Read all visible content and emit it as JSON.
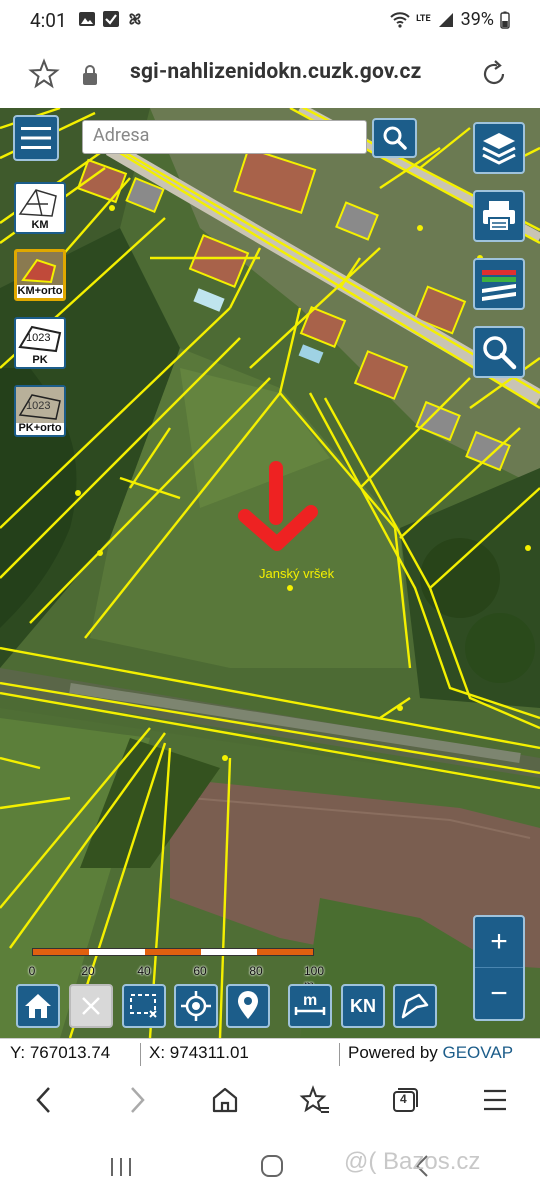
{
  "status_bar": {
    "time": "4:01",
    "battery": "39%",
    "network": "LTE"
  },
  "browser": {
    "url": "sgi-nahlizenidokn.cuzk.gov.cz",
    "tab_count": "4"
  },
  "map": {
    "search_placeholder": "Adresa",
    "place_label": "Janský vršek",
    "layers": [
      {
        "label": "KM",
        "active": false
      },
      {
        "label": "KM+orto",
        "active": true
      },
      {
        "label": "PK",
        "active": false
      },
      {
        "label": "PK+orto",
        "active": false
      }
    ],
    "scale": {
      "ticks": [
        "0",
        "20",
        "40",
        "60",
        "80",
        "100 m"
      ],
      "colors": [
        "#e06010",
        "#ffffff",
        "#e06010",
        "#ffffff",
        "#e06010"
      ]
    },
    "zoom": {
      "plus": "+",
      "minus": "−"
    },
    "tools": {
      "kn": "KN"
    },
    "colors": {
      "parcel_lines": "#f4f000",
      "marker": "#ee2222",
      "control_bg": "#1c5d8a"
    }
  },
  "coords": {
    "y": "Y: 767013.74",
    "x": "X: 974311.01",
    "powered_prefix": "Powered by ",
    "powered_brand": "GEOVAP"
  },
  "watermark": "@( Bazos.cz"
}
